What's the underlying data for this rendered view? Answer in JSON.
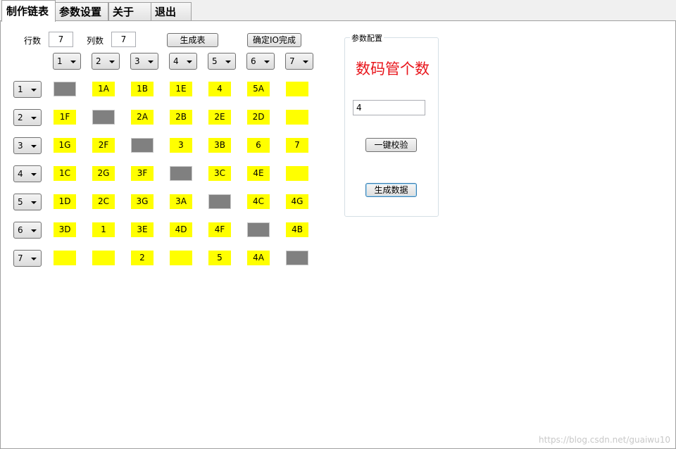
{
  "tabs": [
    {
      "label": "制作链表",
      "active": true
    },
    {
      "label": "参数设置",
      "active": false
    },
    {
      "label": "关于",
      "active": false
    },
    {
      "label": "退出",
      "active": false
    }
  ],
  "controls": {
    "rows_label": "行数",
    "rows_value": "7",
    "cols_label": "列数",
    "cols_value": "7",
    "generate_table_button": "生成表",
    "confirm_io_button": "确定IO完成"
  },
  "column_headers": [
    "1",
    "2",
    "3",
    "4",
    "5",
    "6",
    "7"
  ],
  "row_headers": [
    "1",
    "2",
    "3",
    "4",
    "5",
    "6",
    "7"
  ],
  "grid": [
    [
      {
        "v": "",
        "c": "gray"
      },
      {
        "v": "1A",
        "c": "yellow"
      },
      {
        "v": "1B",
        "c": "yellow"
      },
      {
        "v": "1E",
        "c": "yellow"
      },
      {
        "v": "4",
        "c": "yellow"
      },
      {
        "v": "5A",
        "c": "yellow"
      },
      {
        "v": "",
        "c": "yellow"
      }
    ],
    [
      {
        "v": "1F",
        "c": "yellow"
      },
      {
        "v": "",
        "c": "gray"
      },
      {
        "v": "2A",
        "c": "yellow"
      },
      {
        "v": "2B",
        "c": "yellow"
      },
      {
        "v": "2E",
        "c": "yellow"
      },
      {
        "v": "2D",
        "c": "yellow"
      },
      {
        "v": "",
        "c": "yellow"
      }
    ],
    [
      {
        "v": "1G",
        "c": "yellow"
      },
      {
        "v": "2F",
        "c": "yellow"
      },
      {
        "v": "",
        "c": "gray"
      },
      {
        "v": "3",
        "c": "yellow"
      },
      {
        "v": "3B",
        "c": "yellow"
      },
      {
        "v": "6",
        "c": "yellow"
      },
      {
        "v": "7",
        "c": "yellow"
      }
    ],
    [
      {
        "v": "1C",
        "c": "yellow"
      },
      {
        "v": "2G",
        "c": "yellow"
      },
      {
        "v": "3F",
        "c": "yellow"
      },
      {
        "v": "",
        "c": "gray"
      },
      {
        "v": "3C",
        "c": "yellow"
      },
      {
        "v": "4E",
        "c": "yellow"
      },
      {
        "v": "",
        "c": "yellow"
      }
    ],
    [
      {
        "v": "1D",
        "c": "yellow"
      },
      {
        "v": "2C",
        "c": "yellow"
      },
      {
        "v": "3G",
        "c": "yellow"
      },
      {
        "v": "3A",
        "c": "yellow"
      },
      {
        "v": "",
        "c": "gray"
      },
      {
        "v": "4C",
        "c": "yellow"
      },
      {
        "v": "4G",
        "c": "yellow"
      }
    ],
    [
      {
        "v": "3D",
        "c": "yellow"
      },
      {
        "v": "1",
        "c": "yellow"
      },
      {
        "v": "3E",
        "c": "yellow"
      },
      {
        "v": "4D",
        "c": "yellow"
      },
      {
        "v": "4F",
        "c": "yellow"
      },
      {
        "v": "",
        "c": "gray"
      },
      {
        "v": "4B",
        "c": "yellow"
      }
    ],
    [
      {
        "v": "",
        "c": "yellow"
      },
      {
        "v": "",
        "c": "yellow"
      },
      {
        "v": "2",
        "c": "yellow"
      },
      {
        "v": "",
        "c": "yellow"
      },
      {
        "v": "5",
        "c": "yellow"
      },
      {
        "v": "4A",
        "c": "yellow"
      },
      {
        "v": "",
        "c": "gray"
      }
    ]
  ],
  "param_group": {
    "title": "参数配置",
    "digit_count_label": "数码管个数",
    "digit_count_value": "4",
    "verify_button": "一键校验",
    "generate_data_button": "生成数据"
  },
  "watermark": "https://blog.csdn.net/guaiwu10",
  "colors": {
    "cell_yellow": "#ffff00",
    "cell_gray": "#808080",
    "label_red": "#e8141a"
  }
}
